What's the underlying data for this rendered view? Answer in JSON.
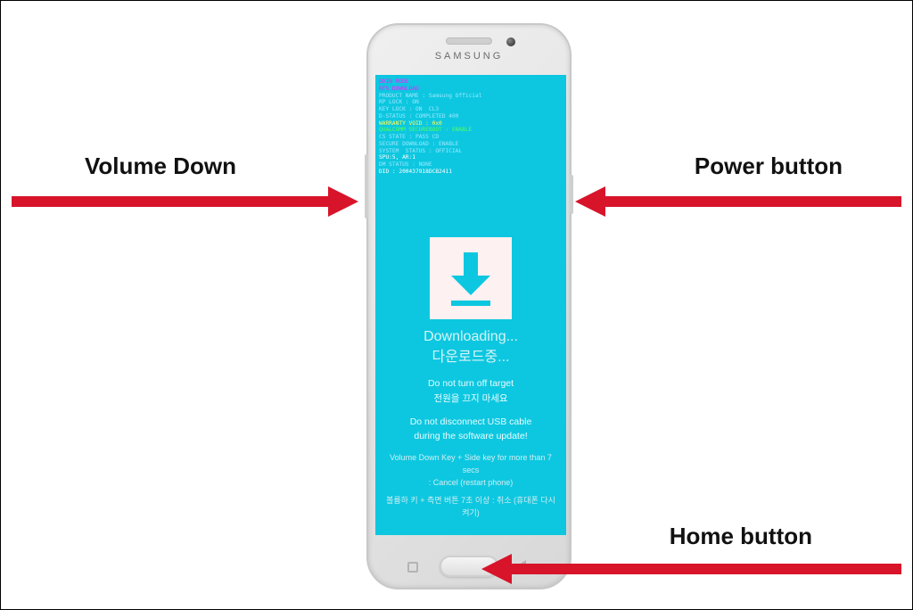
{
  "phone": {
    "brand": "SAMSUNG"
  },
  "debug_lines": [
    {
      "cls": "m",
      "text": "ODIN MODE"
    },
    {
      "cls": "m",
      "text": "RFS DOWNLOAD"
    },
    {
      "cls": "c",
      "text": "PRODUCT NAME : Samsung Official"
    },
    {
      "cls": "c",
      "text": "RP LOCK : ON"
    },
    {
      "cls": "c",
      "text": "KEY LOCK : ON  CL3"
    },
    {
      "cls": "c",
      "text": "D-STATUS : COMPLETED 400"
    },
    {
      "cls": "y",
      "text": "WARRANTY VOID : 0x0"
    },
    {
      "cls": "g",
      "text": "QUALCOMM SECUREBOOT : ENABLE"
    },
    {
      "cls": "c",
      "text": "CS STATE : PASS CD"
    },
    {
      "cls": "c",
      "text": ""
    },
    {
      "cls": "c",
      "text": "SECURE DOWNLOAD : ENABLE"
    },
    {
      "cls": "c",
      "text": "SYSTEM  STATUS : OFFICIAL"
    },
    {
      "cls": "w",
      "text": "SPU:5, AR:1"
    },
    {
      "cls": "c",
      "text": "DM STATUS : NONE"
    },
    {
      "cls": "w",
      "text": "DID : 200437918DCB2411"
    }
  ],
  "download": {
    "title_en": "Downloading...",
    "title_kr": "다운로드중...",
    "warn1_en": "Do not turn off target",
    "warn1_kr": "전원을 끄지 마세요",
    "warn2_en_a": "Do not disconnect USB cable",
    "warn2_en_b": "during the software update!",
    "cancel_en": "Volume Down Key + Side key for more than 7 secs",
    "cancel_en2": ": Cancel (restart phone)",
    "cancel_kr": "볼륨하 키 + 측면 버튼 7초 이상 : 취소 (휴대폰 다시 켜기)"
  },
  "labels": {
    "volume_down": "Volume Down",
    "power": "Power button",
    "home": "Home button"
  },
  "colors": {
    "arrow": "#d7142a",
    "screen": "#0dc7e0"
  }
}
